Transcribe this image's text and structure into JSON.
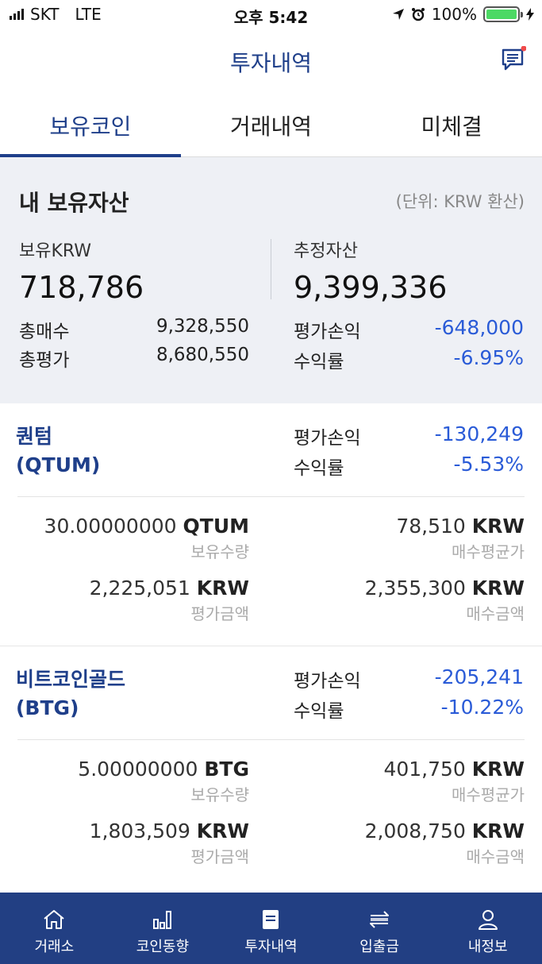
{
  "status_bar": {
    "carrier": "SKT",
    "network": "LTE",
    "time": "오후 5:42",
    "battery": "100%"
  },
  "header": {
    "title": "투자내역"
  },
  "tabs": [
    {
      "label": "보유코인",
      "active": true
    },
    {
      "label": "거래내역",
      "active": false
    },
    {
      "label": "미체결",
      "active": false
    }
  ],
  "summary": {
    "title": "내 보유자산",
    "unit": "(단위: KRW 환산)",
    "krw_label": "보유KRW",
    "krw_value": "718,786",
    "total_label": "추정자산",
    "total_value": "9,399,336",
    "buy_total_label": "총매수",
    "buy_total_value": "9,328,550",
    "eval_total_label": "총평가",
    "eval_total_value": "8,680,550",
    "pl_label": "평가손익",
    "pl_value": "-648,000",
    "rate_label": "수익률",
    "rate_value": "-6.95%"
  },
  "coins": [
    {
      "name": "퀀텀",
      "symbol": "(QTUM)",
      "pl_label": "평가손익",
      "pl_value": "-130,249",
      "rate_label": "수익률",
      "rate_value": "-5.53%",
      "qty_value": "30.00000000",
      "qty_unit": "QTUM",
      "qty_label": "보유수량",
      "avg_value": "78,510",
      "avg_unit": "KRW",
      "avg_label": "매수평균가",
      "eval_value": "2,225,051",
      "eval_unit": "KRW",
      "eval_label": "평가금액",
      "buy_value": "2,355,300",
      "buy_unit": "KRW",
      "buy_label": "매수금액"
    },
    {
      "name": "비트코인골드",
      "symbol": "(BTG)",
      "pl_label": "평가손익",
      "pl_value": "-205,241",
      "rate_label": "수익률",
      "rate_value": "-10.22%",
      "qty_value": "5.00000000",
      "qty_unit": "BTG",
      "qty_label": "보유수량",
      "avg_value": "401,750",
      "avg_unit": "KRW",
      "avg_label": "매수평균가",
      "eval_value": "1,803,509",
      "eval_unit": "KRW",
      "eval_label": "평가금액",
      "buy_value": "2,008,750",
      "buy_unit": "KRW",
      "buy_label": "매수금액"
    }
  ],
  "bottom_nav": [
    {
      "label": "거래소",
      "icon": "home-icon"
    },
    {
      "label": "코인동향",
      "icon": "bar-chart-icon"
    },
    {
      "label": "투자내역",
      "icon": "document-icon"
    },
    {
      "label": "입출금",
      "icon": "transfer-icon"
    },
    {
      "label": "내정보",
      "icon": "user-icon"
    }
  ],
  "colors": {
    "brand": "#1f3f8a",
    "nav_bg": "#223f83",
    "negative": "#2a5bd7",
    "summary_bg": "#eef0f5"
  }
}
